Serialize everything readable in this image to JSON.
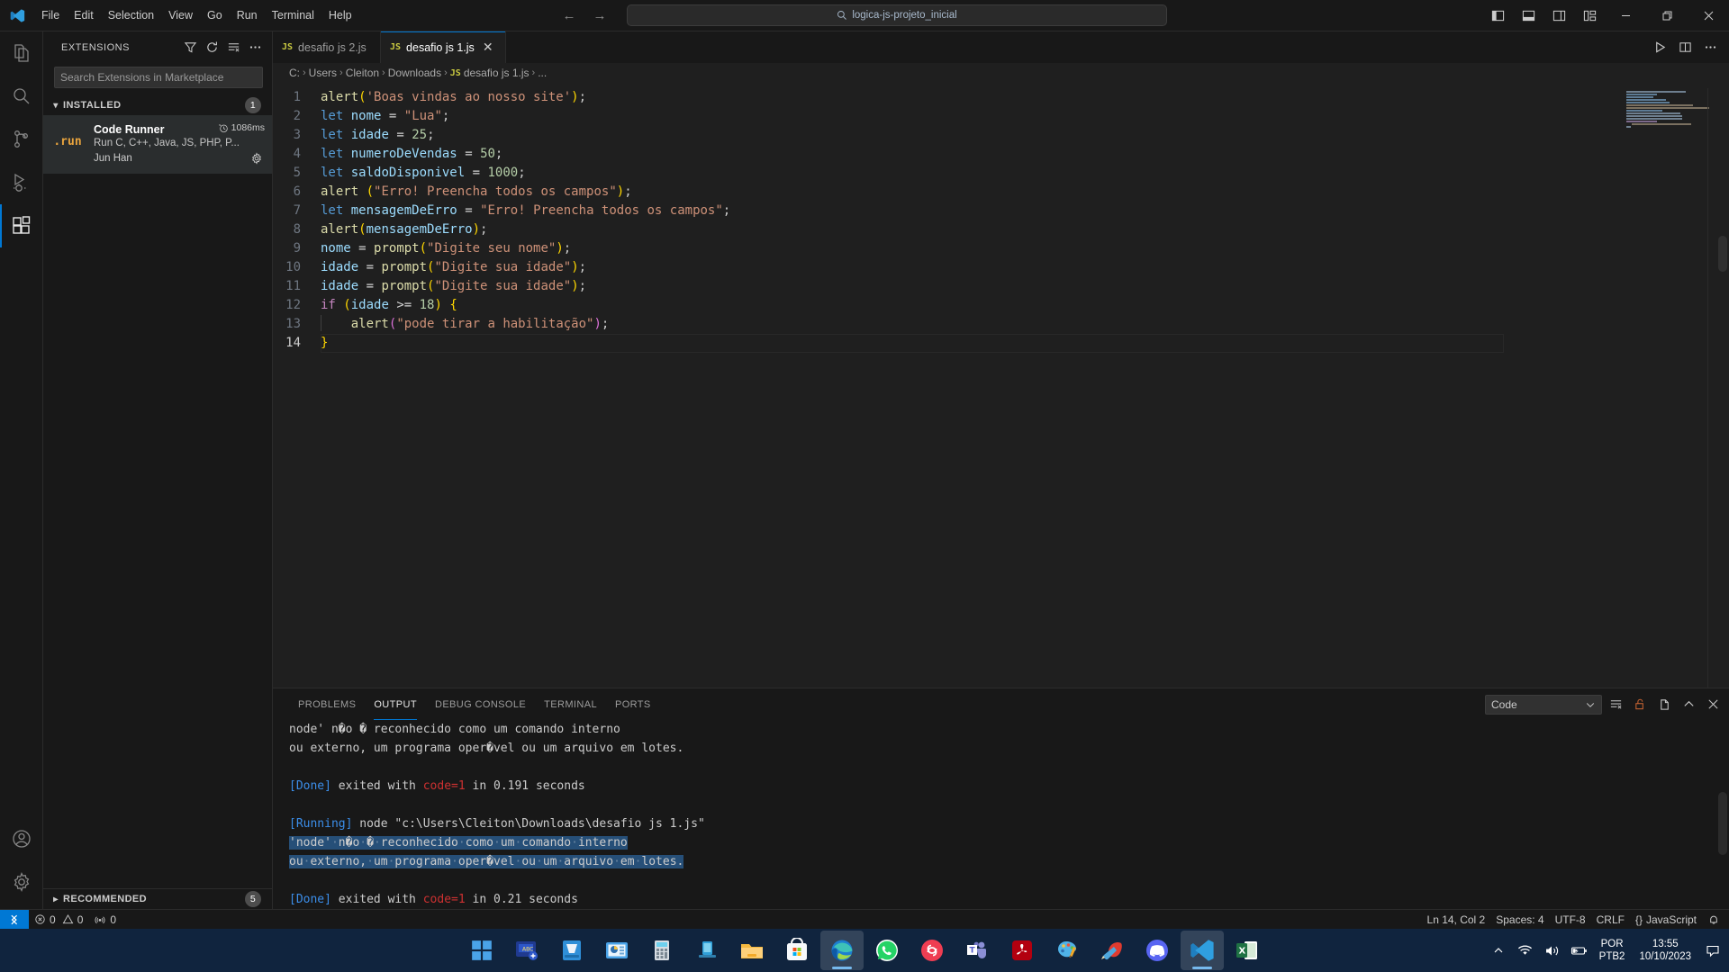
{
  "titlebar": {
    "logo": "vscode-logo",
    "menu": [
      "File",
      "Edit",
      "Selection",
      "View",
      "Go",
      "Run",
      "Terminal",
      "Help"
    ],
    "back_arrow": "←",
    "forward_arrow": "→",
    "search_text": "logica-js-projeto_inicial",
    "layout_buttons": [
      "toggle-primary-sidebar",
      "toggle-panel",
      "toggle-secondary-sidebar",
      "customize-layout"
    ],
    "window_buttons": [
      "minimize",
      "restore",
      "close"
    ]
  },
  "activitybar": {
    "items": [
      {
        "name": "explorer",
        "icon": "files-icon"
      },
      {
        "name": "search",
        "icon": "search-icon"
      },
      {
        "name": "source-control",
        "icon": "source-control-icon"
      },
      {
        "name": "run-and-debug",
        "icon": "run-debug-icon"
      },
      {
        "name": "extensions",
        "icon": "extensions-icon",
        "active": true
      }
    ],
    "bottom": [
      {
        "name": "accounts",
        "icon": "account-icon"
      },
      {
        "name": "manage",
        "icon": "gear-icon"
      }
    ]
  },
  "sidebar": {
    "title": "EXTENSIONS",
    "actions": [
      "filter-icon",
      "refresh-icon",
      "clear-search-icon",
      "more-actions-icon"
    ],
    "search_placeholder": "Search Extensions in Marketplace",
    "search_value": "",
    "installed": {
      "label": "INSTALLED",
      "count": "1",
      "expanded": true
    },
    "extension": {
      "icon_text": ".run",
      "name": "Code Runner",
      "activation_time": "1086ms",
      "description": "Run C, C++, Java, JS, PHP, P...",
      "publisher": "Jun Han",
      "gear": "gear-icon"
    },
    "recommended": {
      "label": "RECOMMENDED",
      "count": "5",
      "expanded": false
    }
  },
  "editor": {
    "tabs": [
      {
        "label": "desafio js 2.js",
        "badge": "JS",
        "active": false,
        "closable": false
      },
      {
        "label": "desafio js 1.js",
        "badge": "JS",
        "active": true,
        "closable": true
      }
    ],
    "tab_actions": [
      "run-code-icon",
      "split-editor-icon",
      "more-actions-icon"
    ],
    "breadcrumbs": [
      "C:",
      "Users",
      "Cleiton",
      "Downloads",
      "desafio js 1.js",
      "..."
    ],
    "breadcrumb_file_badge": "JS",
    "language": "javascript",
    "line_count": 14,
    "current_line": 14,
    "lines": [
      {
        "n": "1",
        "text": "alert('Boas vindas ao nosso site');"
      },
      {
        "n": "2",
        "text": "let nome = \"Lua\";"
      },
      {
        "n": "3",
        "text": "let idade = 25;"
      },
      {
        "n": "4",
        "text": "let numeroDeVendas = 50;"
      },
      {
        "n": "5",
        "text": "let saldoDisponivel = 1000;"
      },
      {
        "n": "6",
        "text": "alert (\"Erro! Preencha todos os campos\");"
      },
      {
        "n": "7",
        "text": "let mensagemDeErro = \"Erro! Preencha todos os campos\";"
      },
      {
        "n": "8",
        "text": "alert(mensagemDeErro);"
      },
      {
        "n": "9",
        "text": "nome = prompt(\"Digite seu nome\");"
      },
      {
        "n": "10",
        "text": "idade = prompt(\"Digite sua idade\");"
      },
      {
        "n": "11",
        "text": "idade = prompt(\"Digite sua idade\");"
      },
      {
        "n": "12",
        "text": "if (idade >= 18) {"
      },
      {
        "n": "13",
        "text": "    alert(\"pode tirar a habilitação\");"
      },
      {
        "n": "14",
        "text": "}"
      }
    ]
  },
  "panel": {
    "tabs": [
      {
        "label": "PROBLEMS",
        "active": false
      },
      {
        "label": "OUTPUT",
        "active": true
      },
      {
        "label": "DEBUG CONSOLE",
        "active": false
      },
      {
        "label": "TERMINAL",
        "active": false
      },
      {
        "label": "PORTS",
        "active": false
      }
    ],
    "channel": "Code",
    "actions": [
      "clear-output-icon",
      "lock-icon",
      "open-in-editor-icon",
      "collapse-panel-icon",
      "close-panel-icon"
    ],
    "output_lines": [
      "node' n�o � reconhecido como um comando interno",
      "ou externo, um programa oper�vel ou um arquivo em lotes.",
      "",
      "[Done] exited with code=1 in 0.191 seconds",
      "",
      "[Running] node \"c:\\Users\\Cleiton\\Downloads\\desafio js 1.js\"",
      "'node' n�o � reconhecido como um comando interno",
      "ou externo, um programa oper�vel ou um arquivo em lotes.",
      "",
      "[Done] exited with code=1 in 0.21 seconds"
    ]
  },
  "statusbar": {
    "remote_icon": "remote-window-icon",
    "errors": "0",
    "warnings": "0",
    "ports": "0",
    "cursor_position": "Ln 14, Col 2",
    "indentation": "Spaces: 4",
    "encoding": "UTF-8",
    "eol": "CRLF",
    "language_mode": "JavaScript",
    "language_prefix": "{}",
    "notifications_icon": "bell-icon"
  },
  "taskbar": {
    "items": [
      {
        "name": "start",
        "icon": "windows-start-icon"
      },
      {
        "name": "quick-assist",
        "icon": "blue-abc-icon"
      },
      {
        "name": "scanner",
        "icon": "scanner-icon"
      },
      {
        "name": "powerpoint",
        "icon": "presentation-icon"
      },
      {
        "name": "calculator",
        "icon": "calculator-icon"
      },
      {
        "name": "device",
        "icon": "device-icon"
      },
      {
        "name": "file-explorer",
        "icon": "folder-icon"
      },
      {
        "name": "microsoft-store",
        "icon": "store-icon"
      },
      {
        "name": "microsoft-edge",
        "icon": "edge-icon",
        "active": true
      },
      {
        "name": "whatsapp",
        "icon": "whatsapp-icon"
      },
      {
        "name": "red-app",
        "icon": "red-circle-icon"
      },
      {
        "name": "microsoft-teams",
        "icon": "teams-icon"
      },
      {
        "name": "adobe-acrobat",
        "icon": "acrobat-icon"
      },
      {
        "name": "paint",
        "icon": "paint-palette-icon"
      },
      {
        "name": "ccleaner",
        "icon": "ccleaner-icon"
      },
      {
        "name": "discord",
        "icon": "discord-icon"
      },
      {
        "name": "visual-studio-code",
        "icon": "vscode-icon",
        "active": true
      },
      {
        "name": "excel",
        "icon": "excel-icon"
      }
    ],
    "tray": {
      "overflow": "show-hidden-icons",
      "wifi": "wifi-icon",
      "volume": "volume-icon",
      "battery": "battery-charging-icon",
      "language_line1": "POR",
      "language_line2": "PTB2",
      "time": "13:55",
      "date": "10/10/2023",
      "notifications": "chat-bubble-icon"
    }
  },
  "colors": {
    "accent": "#0078d4",
    "titlebar_bg": "#181818",
    "editor_bg": "#1f1f1f",
    "taskbar_bg": "#10243e",
    "selection": "#264f78",
    "error": "#cd3131",
    "info": "#3b8eea"
  }
}
